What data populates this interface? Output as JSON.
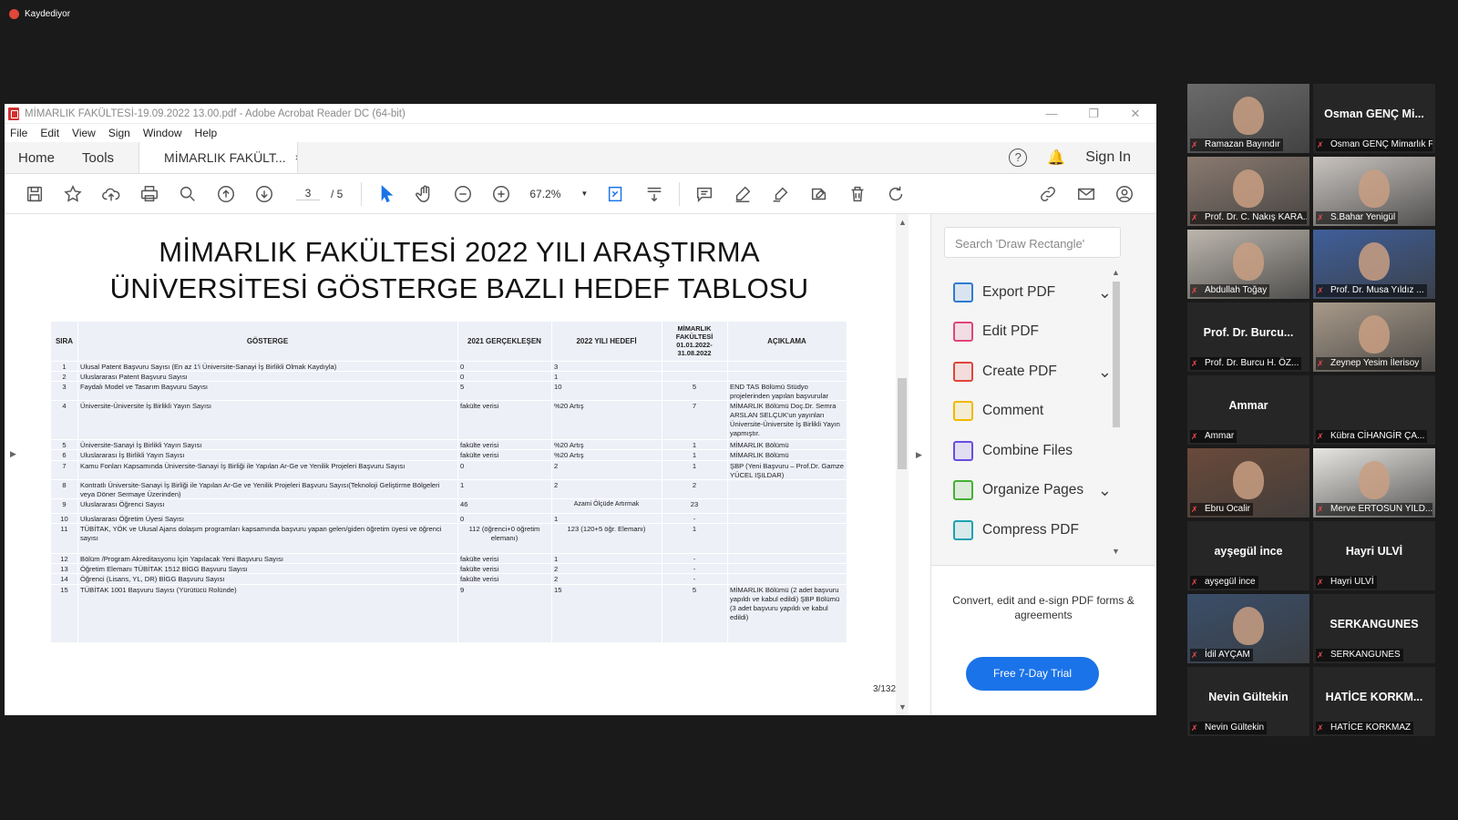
{
  "recording": {
    "label": "Kaydediyor"
  },
  "window": {
    "title": "MİMARLIK FAKÜLTESİ-19.09.2022 13.00.pdf - Adobe Acrobat Reader DC (64-bit)",
    "menu": [
      "File",
      "Edit",
      "View",
      "Sign",
      "Window",
      "Help"
    ]
  },
  "tabs": {
    "home": "Home",
    "tools": "Tools",
    "doc": "MİMARLIK FAKÜLT...",
    "close": "×",
    "sign_in": "Sign In"
  },
  "toolbar": {
    "page_current": "3",
    "page_total": "/ 5",
    "zoom": "67.2%"
  },
  "document": {
    "title_line1": "MİMARLIK FAKÜLTESİ 2022 YILI ARAŞTIRMA",
    "title_line2": "ÜNİVERSİTESİ GÖSTERGE BAZLI HEDEF TABLOSU",
    "columns": [
      "SIRA",
      "GÖSTERGE",
      "2021 GERÇEKLEŞEN",
      "2022 YILI HEDEFİ",
      "MİMARLIK FAKÜLTESİ 01.01.2022-31.08.2022",
      "AÇIKLAMA"
    ],
    "rows": [
      {
        "n": "1",
        "g": "Ulusal Patent Başvuru Sayısı (En az 1'i Üniversite-Sanayi İş Birlikli Olmak Kaydıyla)",
        "r2021": "0",
        "h2022": "3",
        "mf": "",
        "a": ""
      },
      {
        "n": "2",
        "g": "Uluslararası Patent Başvuru Sayısı",
        "r2021": "0",
        "h2022": "1",
        "mf": "",
        "a": ""
      },
      {
        "n": "3",
        "g": "Faydalı Model ve Tasarım Başvuru Sayısı",
        "r2021": "5",
        "h2022": "10",
        "mf": "5",
        "a": "END TAS Bölümü Stüdyo projelerinden yapılan başvurular"
      },
      {
        "n": "4",
        "g": "Üniversite-Üniversite İş Birlikli Yayın Sayısı",
        "r2021": "fakülte verisi",
        "h2022": "%20 Artış",
        "mf": "7",
        "a": "MİMARLIK Bölümü Doç.Dr. Semra ARSLAN SELÇUK'un yayınları Üniversite-Üniversite İş Birlikli Yayın yapmıştır."
      },
      {
        "n": "5",
        "g": "Üniversite-Sanayi İş Birlikli Yayın Sayısı",
        "r2021": "fakülte verisi",
        "h2022": "%20 Artış",
        "mf": "1",
        "a": "MİMARLIK Bölümü"
      },
      {
        "n": "6",
        "g": "Uluslararası İş Birlikli Yayın Sayısı",
        "r2021": "fakülte verisi",
        "h2022": "%20 Artış",
        "mf": "1",
        "a": "MİMARLIK Bölümü"
      },
      {
        "n": "7",
        "g": "Kamu Fonları Kapsamında Üniversite-Sanayi İş Birliği ile Yapılan Ar-Ge ve Yenilik Projeleri Başvuru Sayısı",
        "r2021": "0",
        "h2022": "2",
        "mf": "1",
        "a": "ŞBP (Yeni Başvuru – Prof.Dr. Gamze YÜCEL IŞILDAR)"
      },
      {
        "n": "8",
        "g": "Kontratlı Üniversite-Sanayi İş Birliği ile Yapılan Ar-Ge ve Yenilik Projeleri Başvuru Sayısı(Teknoloji Geliştirme Bölgeleri veya Döner Sermaye Üzerinden)",
        "r2021": "1",
        "h2022": "2",
        "mf": "2",
        "a": ""
      },
      {
        "n": "9",
        "g": "Uluslararası Öğrenci Sayısı",
        "r2021": "46",
        "h2022": "Azami Ölçüde Artırmak",
        "mf": "23",
        "a": ""
      },
      {
        "n": "10",
        "g": "Uluslararası Öğretim Üyesi Sayısı",
        "r2021": "0",
        "h2022": "1",
        "mf": "-",
        "a": ""
      },
      {
        "n": "11",
        "g": "TÜBİTAK, YÖK ve Ulusal Ajans dolaşım programları kapsamında başvuru yapan gelen/giden öğretim üyesi ve öğrenci sayısı",
        "r2021": "112 (öğrenci+0 öğretim elemanı)",
        "h2022": "123 (120+5 öğr. Elemanı)",
        "mf": "1",
        "a": ""
      },
      {
        "n": "12",
        "g": "Bölüm /Program Akreditasyonu İçin Yapılacak Yeni Başvuru Sayısı",
        "r2021": "fakülte verisi",
        "h2022": "1",
        "mf": "-",
        "a": ""
      },
      {
        "n": "13",
        "g": "Öğretim Elemanı TÜBİTAK 1512 BİGG Başvuru Sayısı",
        "r2021": "fakülte verisi",
        "h2022": "2",
        "mf": "-",
        "a": ""
      },
      {
        "n": "14",
        "g": "Öğrenci (Lisans, YL, DR) BİGG Başvuru Sayısı",
        "r2021": "fakülte verisi",
        "h2022": "2",
        "mf": "-",
        "a": ""
      },
      {
        "n": "15",
        "g": "TÜBİTAK 1001 Başvuru Sayısı (Yürütücü Rolünde)",
        "r2021": "9",
        "h2022": "15",
        "mf": "5",
        "a": "MİMARLIK Bölümü (2 adet başvuru yapıldı ve kabul edildi) ŞBP Bölümü (3 adet başvuru yapıldı ve kabul edildi)"
      }
    ],
    "page_indicator": "3/132"
  },
  "right_panel": {
    "search_placeholder": "Search 'Draw Rectangle'",
    "tools": [
      {
        "label": "Export PDF",
        "icon": "export-pdf-icon",
        "color": "#2f7bd1",
        "chevron": true
      },
      {
        "label": "Edit PDF",
        "icon": "edit-pdf-icon",
        "color": "#e0457b",
        "chevron": false
      },
      {
        "label": "Create PDF",
        "icon": "create-pdf-icon",
        "color": "#e0453a",
        "chevron": true
      },
      {
        "label": "Comment",
        "icon": "comment-icon",
        "color": "#f2b800",
        "chevron": false
      },
      {
        "label": "Combine Files",
        "icon": "combine-files-icon",
        "color": "#6a4ce0",
        "chevron": false
      },
      {
        "label": "Organize Pages",
        "icon": "organize-pages-icon",
        "color": "#45b035",
        "chevron": true
      },
      {
        "label": "Compress PDF",
        "icon": "compress-pdf-icon",
        "color": "#1fa1b0",
        "chevron": false
      }
    ],
    "promo_text": "Convert, edit and e-sign PDF forms & agreements",
    "trial_button": "Free 7-Day Trial"
  },
  "participants": [
    {
      "name": "Ramazan Bayındır",
      "big": "",
      "video": true,
      "color": "#6b6b6b",
      "active": false
    },
    {
      "name": "Osman GENÇ Mimarlık F...",
      "big": "Osman GENÇ Mi...",
      "video": false,
      "active": false
    },
    {
      "name": "Prof. Dr. C. Nakış KARA...",
      "big": "",
      "video": true,
      "color": "#8a7a70",
      "active": true
    },
    {
      "name": "S.Bahar Yenigül",
      "big": "",
      "video": true,
      "color": "#c9c4c0",
      "active": false
    },
    {
      "name": "Abdullah Toğay",
      "big": "",
      "video": true,
      "color": "#bcb6ad",
      "active": false
    },
    {
      "name": "Prof. Dr. Musa Yıldız ...",
      "big": "",
      "video": true,
      "color": "#3f5f9a",
      "active": false
    },
    {
      "name": "Prof. Dr. Burcu H. ÖZ...",
      "big": "Prof. Dr. Burcu...",
      "video": false,
      "active": false
    },
    {
      "name": "Zeynep Yesim İlerisoy",
      "big": "",
      "video": true,
      "color": "#a89a8a",
      "active": false
    },
    {
      "name": "Ammar",
      "big": "Ammar",
      "video": false,
      "active": false
    },
    {
      "name": "Kübra CİHANGİR ÇA...",
      "big": "",
      "video": false,
      "active": false
    },
    {
      "name": "Ebru Ocalir",
      "big": "",
      "video": true,
      "color": "#6a4a3a",
      "active": false
    },
    {
      "name": "Merve ERTOSUN YILD...",
      "big": "",
      "video": true,
      "color": "#e8e6e2",
      "active": false
    },
    {
      "name": "ayşegül ince",
      "big": "ayşegül ince",
      "video": false,
      "active": false
    },
    {
      "name": "Hayri ULVİ",
      "big": "Hayri ULVİ",
      "video": false,
      "active": false
    },
    {
      "name": "İdil AYÇAM",
      "big": "",
      "video": true,
      "color": "#3a4e6a",
      "active": false
    },
    {
      "name": "SERKANGUNES",
      "big": "SERKANGUNES",
      "video": false,
      "active": false
    },
    {
      "name": "Nevin Gültekin",
      "big": "Nevin Gültekin",
      "video": false,
      "active": false
    },
    {
      "name": "HATİCE KORKMAZ",
      "big": "HATİCE KORKM...",
      "video": false,
      "active": false
    }
  ]
}
